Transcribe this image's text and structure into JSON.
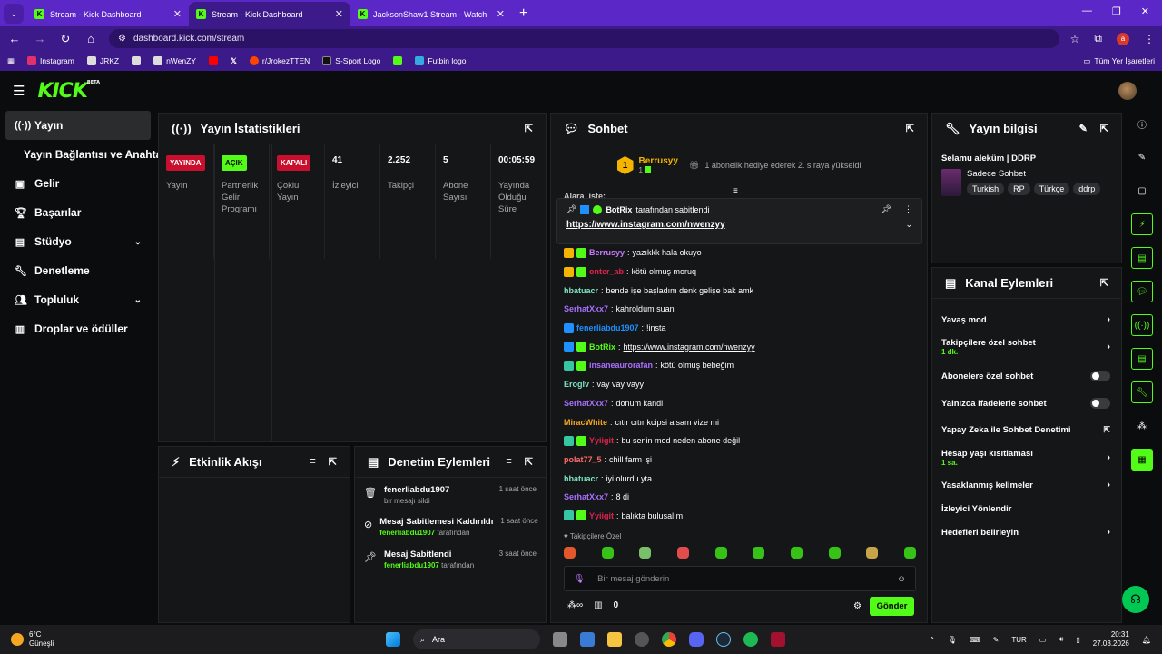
{
  "browser": {
    "tabs": [
      {
        "title": "Stream - Kick Dashboard",
        "active": false
      },
      {
        "title": "Stream - Kick Dashboard",
        "active": true
      },
      {
        "title": "JacksonShaw1 Stream - Watch",
        "active": false
      }
    ],
    "url": "dashboard.kick.com/stream",
    "profile_initial": "a",
    "bookmarks": [
      "Instagram",
      "JRKZ",
      "",
      "nWenZY",
      "",
      "",
      "r/JrokezTTEN",
      "S-Sport Logo",
      "",
      "Futbin logo"
    ],
    "bookmarks_all": "Tüm Yer İşaretleri"
  },
  "app": {
    "logo": "KICK",
    "logo_tag": "BETA",
    "accent": "#53fc18"
  },
  "sidebar": {
    "items": [
      {
        "label": "Yayın",
        "icon": "broadcast-icon",
        "active": true
      },
      {
        "label": "Yayın Bağlantısı ve Anahtarı",
        "icon": "",
        "active": false
      },
      {
        "label": "Gelir",
        "icon": "revenue-icon"
      },
      {
        "label": "Başarılar",
        "icon": "trophy-icon"
      },
      {
        "label": "Stüdyo",
        "icon": "studio-icon",
        "chevron": true
      },
      {
        "label": "Denetleme",
        "icon": "wrench-icon"
      },
      {
        "label": "Topluluk",
        "icon": "community-icon",
        "chevron": true
      },
      {
        "label": "Droplar ve ödüller",
        "icon": "drops-icon"
      }
    ]
  },
  "stats": {
    "title": "Yayın İstatistikleri",
    "cols": [
      {
        "badge": "YAYINDA",
        "badge_color": "#c8102e",
        "value": "",
        "label": "Yayın"
      },
      {
        "badge": "AÇIK",
        "badge_color": "#53fc18",
        "value": "",
        "label": "Partnerlik Gelir Programı"
      },
      {
        "badge": "KAPALI",
        "badge_color": "#c8102e",
        "value": "",
        "label": "Çoklu Yayın"
      },
      {
        "badge": "",
        "value": "41",
        "label": "İzleyici"
      },
      {
        "badge": "",
        "value": "2.252",
        "label": "Takipçi"
      },
      {
        "badge": "",
        "value": "5",
        "label": "Abone Sayısı"
      },
      {
        "badge": "",
        "value": "00:05:59",
        "label": "Yayında Olduğu Süre"
      }
    ]
  },
  "activity": {
    "title": "Etkinlik Akışı"
  },
  "modlog": {
    "title": "Denetim Eylemleri",
    "items": [
      {
        "title": "fenerliabdu1907",
        "sub": "bir mesajı sildi",
        "by": "",
        "time": "1 saat önce",
        "icon": "trash-icon"
      },
      {
        "title": "Mesaj Sabitlemesi Kaldırıldı",
        "sub": "tarafından",
        "by": "fenerliabdu1907",
        "time": "1 saat önce",
        "icon": "unpin-icon"
      },
      {
        "title": "Mesaj Sabitlendi",
        "sub": "tarafından",
        "by": "fenerliabdu1907",
        "time": "3 saat önce",
        "icon": "pin-icon"
      }
    ]
  },
  "chat": {
    "title": "Sohbet",
    "gifter": "Berrusyy",
    "gifter_rank": "1",
    "gift_msg": "1 abonelik hediye ederek 2. sıraya yükseldi",
    "pinned_by": "BotRix",
    "pinned_by_suffix": "tarafından sabitlendi",
    "pinned_link": "https://www.instagram.com/nwenzyy",
    "cut_user": "Alara_iste:",
    "messages": [
      {
        "user": "Berrusyy",
        "color": "#c77dff",
        "text": "yazıkkk hala okuyo",
        "badges": [
          "#f5b400",
          "#53fc18"
        ]
      },
      {
        "user": "onter_ab",
        "color": "#e0234e",
        "text": "kötü olmuş moruq",
        "badges": [
          "#f5b400",
          "#53fc18"
        ]
      },
      {
        "user": "hbatuacr",
        "color": "#7ee2c4",
        "text": "bende işe başladım denk gelişe bak amk",
        "badges": []
      },
      {
        "user": "SerhatXxx7",
        "color": "#a970ff",
        "text": "kahroldum suan",
        "badges": []
      },
      {
        "user": "fenerliabdu1907",
        "color": "#1e90ff",
        "text": "!insta",
        "badges": [
          "#1e90ff"
        ]
      },
      {
        "user": "BotRix",
        "color": "#53fc18",
        "text": "https://www.instagram.com/nwenzyy",
        "badges": [
          "#1e90ff",
          "#53fc18"
        ],
        "link": true
      },
      {
        "user": "insaneaurorafan",
        "color": "#a970ff",
        "text": "kötü olmuş bebeğim",
        "badges": [
          "#36c6a4",
          "#53fc18"
        ]
      },
      {
        "user": "Eroglv",
        "color": "#7ee2c4",
        "text": "vay vay vayy",
        "badges": []
      },
      {
        "user": "SerhatXxx7",
        "color": "#a970ff",
        "text": "donum kandi",
        "badges": []
      },
      {
        "user": "MiracWhite",
        "color": "#f5a623",
        "text": "cıtır cıtır kcipsi alsam vize mi",
        "badges": []
      },
      {
        "user": "Yyiigit",
        "color": "#e0234e",
        "text": "bu senin mod neden abone değil",
        "badges": [
          "#36c6a4",
          "#53fc18"
        ]
      },
      {
        "user": "polat77_5",
        "color": "#ff6b6b",
        "text": "chill farm işi",
        "badges": []
      },
      {
        "user": "hbatuacr",
        "color": "#7ee2c4",
        "text": "iyi olurdu yta",
        "badges": []
      },
      {
        "user": "SerhatXxx7",
        "color": "#a970ff",
        "text": "8 di",
        "badges": []
      },
      {
        "user": "Yyiigit",
        "color": "#e0234e",
        "text": "balıkta bulusalım",
        "badges": [
          "#36c6a4",
          "#53fc18"
        ]
      }
    ],
    "followers_only": "Takipçilere Özel",
    "input_placeholder": "Bir mesaj gönderin",
    "infinity": "∞",
    "count": "0",
    "send": "Gönder"
  },
  "stream_info": {
    "title": "Yayın bilgisi",
    "stream_title": "Selamu aleküm | DDRP",
    "category": "Sadece Sohbet",
    "tags": [
      "Turkish",
      "RP",
      "Türkçe",
      "ddrp"
    ]
  },
  "channel_actions": {
    "title": "Kanal Eylemleri",
    "items": [
      {
        "label": "Yavaş mod",
        "sub": "",
        "kind": "chevron"
      },
      {
        "label": "Takipçilere özel sohbet",
        "sub": "1 dk.",
        "kind": "chevron"
      },
      {
        "label": "Abonelere özel sohbet",
        "sub": "",
        "kind": "toggle"
      },
      {
        "label": "Yalnızca ifadelerle sohbet",
        "sub": "",
        "kind": "toggle"
      },
      {
        "label": "Yapay Zeka ile Sohbet Denetimi",
        "sub": "",
        "kind": "external"
      },
      {
        "label": "Hesap yaşı kısıtlaması",
        "sub": "1 sa.",
        "kind": "chevron"
      },
      {
        "label": "Yasaklanmış kelimeler",
        "sub": "",
        "kind": "chevron"
      },
      {
        "label": "İzleyici Yönlendir",
        "sub": "",
        "kind": "none"
      },
      {
        "label": "Hedefleri belirleyin",
        "sub": "",
        "kind": "chevron"
      }
    ]
  },
  "taskbar": {
    "weather_temp": "6°C",
    "weather_desc": "Güneşli",
    "search": "Ara",
    "lang": "TUR",
    "time": "20:31",
    "date": "27.03.2026"
  }
}
